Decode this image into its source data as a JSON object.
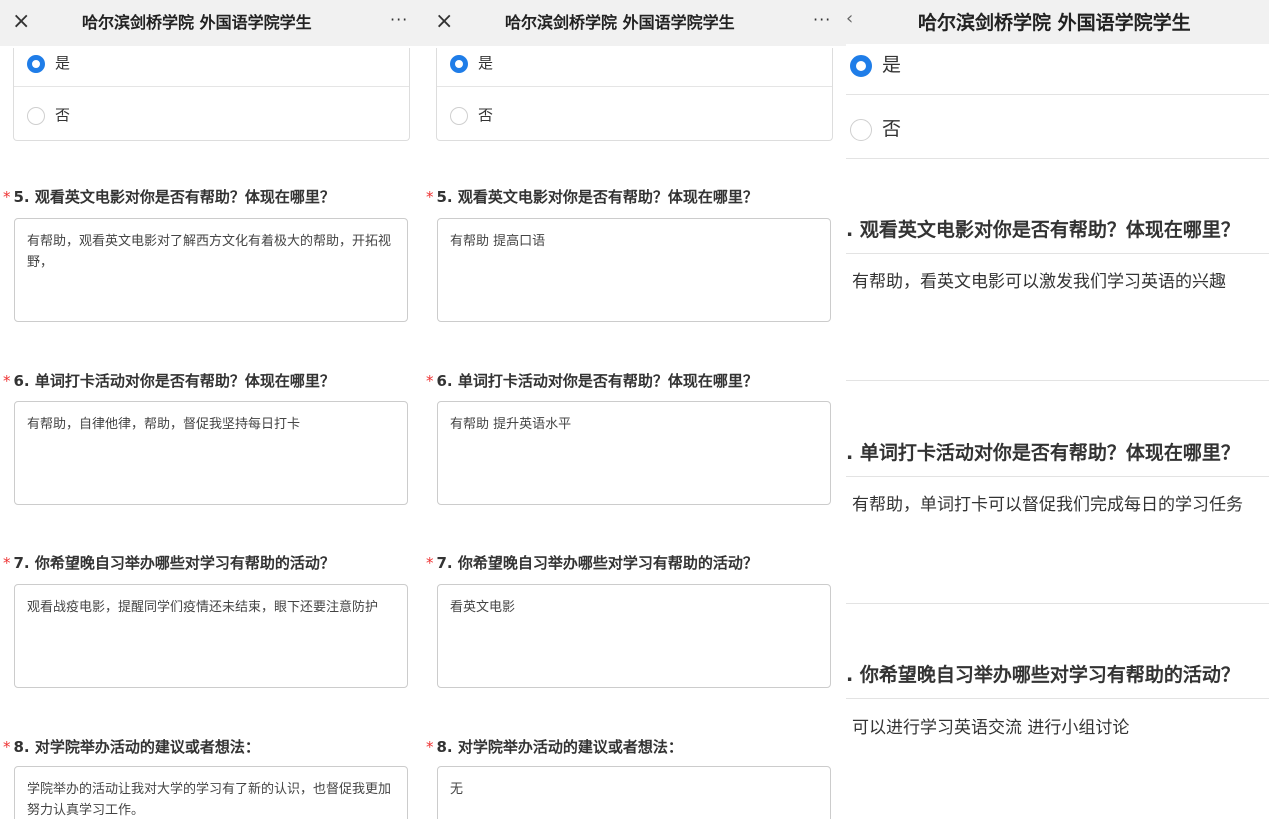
{
  "panels": [
    {
      "title": "哈尔滨剑桥学院 外国语学院学生",
      "close_icon": "×",
      "more_icon": "···",
      "options": [
        "是",
        "否"
      ],
      "questions": [
        {
          "star": "*",
          "label": "5. 观看英文电影对你是否有帮助？体现在哪里？",
          "answer": "有帮助，观看英文电影对了解西方文化有着极大的帮助，开拓视野，"
        },
        {
          "star": "*",
          "label": "6. 单词打卡活动对你是否有帮助？体现在哪里？",
          "answer": "有帮助，自律他律，帮助，督促我坚持每日打卡"
        },
        {
          "star": "*",
          "label": "7. 你希望晚自习举办哪些对学习有帮助的活动？",
          "answer": "观看战疫电影，提醒同学们疫情还未结束，眼下还要注意防护"
        },
        {
          "star": "*",
          "label": "8. 对学院举办活动的建议或者想法：",
          "answer": "学院举办的活动让我对大学的学习有了新的认识，也督促我更加努力认真学习工作。"
        }
      ]
    },
    {
      "title": "哈尔滨剑桥学院 外国语学院学生",
      "close_icon": "×",
      "more_icon": "···",
      "options": [
        "是",
        "否"
      ],
      "questions": [
        {
          "star": "*",
          "label": "5. 观看英文电影对你是否有帮助？体现在哪里？",
          "answer": "有帮助 提高口语"
        },
        {
          "star": "*",
          "label": "6. 单词打卡活动对你是否有帮助？体现在哪里？",
          "answer": "有帮助 提升英语水平"
        },
        {
          "star": "*",
          "label": "7. 你希望晚自习举办哪些对学习有帮助的活动？",
          "answer": "看英文电影"
        },
        {
          "star": "*",
          "label": "8. 对学院举办活动的建议或者想法：",
          "answer": "无"
        }
      ]
    },
    {
      "title": "哈尔滨剑桥学院 外国语学院学生",
      "back_icon": "‹",
      "options": [
        "是",
        "否"
      ],
      "questions": [
        {
          "label": ". 观看英文电影对你是否有帮助？体现在哪里？",
          "answer": "有帮助，看英文电影可以激发我们学习英语的兴趣"
        },
        {
          "label": ". 单词打卡活动对你是否有帮助？体现在哪里？",
          "answer": "有帮助，单词打卡可以督促我们完成每日的学习任务"
        },
        {
          "label": ". 你希望晚自习举办哪些对学习有帮助的活动？",
          "answer": "可以进行学习英语交流 进行小组讨论"
        }
      ]
    }
  ],
  "colors": {
    "accent": "#1f7de8",
    "required_star": "#e33333",
    "topbar": "#f1f1f1"
  }
}
